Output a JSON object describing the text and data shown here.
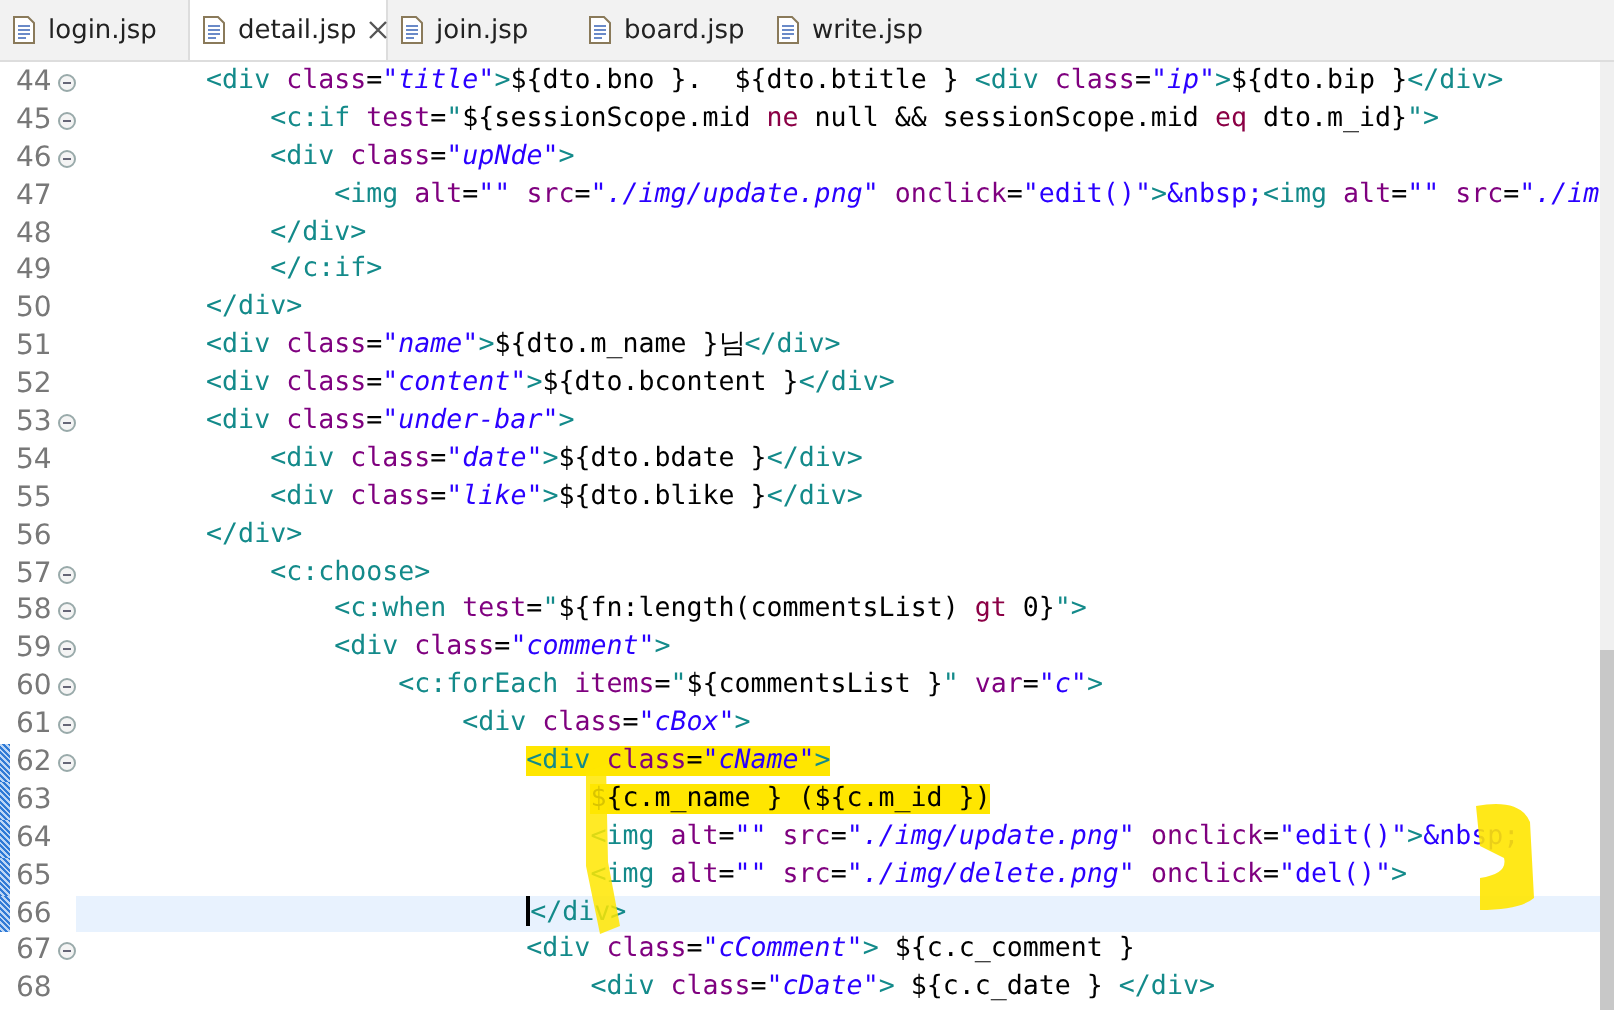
{
  "tabs": [
    {
      "label": "login.jsp",
      "selected": false
    },
    {
      "label": "detail.jsp",
      "selected": true
    },
    {
      "label": "join.jsp",
      "selected": false
    },
    {
      "label": "board.jsp",
      "selected": false
    },
    {
      "label": "write.jsp",
      "selected": false
    }
  ],
  "editor": {
    "lines": [
      {
        "number": "44",
        "fold": true,
        "changed": false,
        "current": false,
        "highlighted": false,
        "tokens": [
          {
            "kind": "tag",
            "text": "        <div"
          },
          {
            "kind": "attr",
            "text": " class"
          },
          {
            "kind": "txt",
            "text": "="
          },
          {
            "kind": "str",
            "text": "\"title\""
          },
          {
            "kind": "tag",
            "text": ">"
          },
          {
            "kind": "el",
            "text": "${dto.bno }.  ${dto.btitle } "
          },
          {
            "kind": "tag",
            "text": "<div"
          },
          {
            "kind": "attr",
            "text": " class"
          },
          {
            "kind": "txt",
            "text": "="
          },
          {
            "kind": "str",
            "text": "\"ip\""
          },
          {
            "kind": "tag",
            "text": ">"
          },
          {
            "kind": "el",
            "text": "${dto.bip }"
          },
          {
            "kind": "tag",
            "text": "</div>"
          }
        ]
      },
      {
        "number": "45",
        "fold": true,
        "changed": false,
        "current": false,
        "highlighted": false,
        "tokens": [
          {
            "kind": "tag",
            "text": "            <c:if"
          },
          {
            "kind": "attr",
            "text": " test"
          },
          {
            "kind": "txt",
            "text": "="
          },
          {
            "kind": "q",
            "text": "\""
          },
          {
            "kind": "el",
            "text": "${sessionScope.mid "
          },
          {
            "kind": "op",
            "text": "ne"
          },
          {
            "kind": "el",
            "text": " null && sessionScope.mid "
          },
          {
            "kind": "op",
            "text": "eq"
          },
          {
            "kind": "el",
            "text": " dto.m_id}"
          },
          {
            "kind": "q",
            "text": "\""
          },
          {
            "kind": "tag",
            "text": ">"
          }
        ]
      },
      {
        "number": "46",
        "fold": true,
        "changed": false,
        "current": false,
        "highlighted": false,
        "tokens": [
          {
            "kind": "tag",
            "text": "            <div"
          },
          {
            "kind": "attr",
            "text": " class"
          },
          {
            "kind": "txt",
            "text": "="
          },
          {
            "kind": "str",
            "text": "\"upNde\""
          },
          {
            "kind": "tag",
            "text": ">"
          }
        ]
      },
      {
        "number": "47",
        "fold": false,
        "changed": false,
        "current": false,
        "highlighted": false,
        "tokens": [
          {
            "kind": "tag",
            "text": "                <img"
          },
          {
            "kind": "attr",
            "text": " alt"
          },
          {
            "kind": "txt",
            "text": "="
          },
          {
            "kind": "str",
            "text": "\"\""
          },
          {
            "kind": "attr",
            "text": " src"
          },
          {
            "kind": "txt",
            "text": "="
          },
          {
            "kind": "str",
            "text": "\"./img/update.png\""
          },
          {
            "kind": "attr",
            "text": " onclick"
          },
          {
            "kind": "txt",
            "text": "="
          },
          {
            "kind": "val",
            "text": "\"edit()\""
          },
          {
            "kind": "tag",
            "text": ">"
          },
          {
            "kind": "ent",
            "text": "&nbsp;"
          },
          {
            "kind": "tag",
            "text": "<img"
          },
          {
            "kind": "attr",
            "text": " alt"
          },
          {
            "kind": "txt",
            "text": "="
          },
          {
            "kind": "str",
            "text": "\"\""
          },
          {
            "kind": "attr",
            "text": " src"
          },
          {
            "kind": "txt",
            "text": "="
          },
          {
            "kind": "str",
            "text": "\"./im"
          }
        ]
      },
      {
        "number": "48",
        "fold": false,
        "changed": false,
        "current": false,
        "highlighted": false,
        "tokens": [
          {
            "kind": "tag",
            "text": "            </div>"
          }
        ]
      },
      {
        "number": "49",
        "fold": false,
        "changed": false,
        "current": false,
        "highlighted": false,
        "tokens": [
          {
            "kind": "tag",
            "text": "            </c:if>"
          }
        ]
      },
      {
        "number": "50",
        "fold": false,
        "changed": false,
        "current": false,
        "highlighted": false,
        "tokens": [
          {
            "kind": "tag",
            "text": "        </div>"
          }
        ]
      },
      {
        "number": "51",
        "fold": false,
        "changed": false,
        "current": false,
        "highlighted": false,
        "tokens": [
          {
            "kind": "tag",
            "text": "        <div"
          },
          {
            "kind": "attr",
            "text": " class"
          },
          {
            "kind": "txt",
            "text": "="
          },
          {
            "kind": "str",
            "text": "\"name\""
          },
          {
            "kind": "tag",
            "text": ">"
          },
          {
            "kind": "el",
            "text": "${dto.m_name }님"
          },
          {
            "kind": "tag",
            "text": "</div>"
          }
        ]
      },
      {
        "number": "52",
        "fold": false,
        "changed": false,
        "current": false,
        "highlighted": false,
        "tokens": [
          {
            "kind": "tag",
            "text": "        <div"
          },
          {
            "kind": "attr",
            "text": " class"
          },
          {
            "kind": "txt",
            "text": "="
          },
          {
            "kind": "str",
            "text": "\"content\""
          },
          {
            "kind": "tag",
            "text": ">"
          },
          {
            "kind": "el",
            "text": "${dto.bcontent }"
          },
          {
            "kind": "tag",
            "text": "</div>"
          }
        ]
      },
      {
        "number": "53",
        "fold": true,
        "changed": false,
        "current": false,
        "highlighted": false,
        "tokens": [
          {
            "kind": "tag",
            "text": "        <div"
          },
          {
            "kind": "attr",
            "text": " class"
          },
          {
            "kind": "txt",
            "text": "="
          },
          {
            "kind": "str",
            "text": "\"under-bar\""
          },
          {
            "kind": "tag",
            "text": ">"
          }
        ]
      },
      {
        "number": "54",
        "fold": false,
        "changed": false,
        "current": false,
        "highlighted": false,
        "tokens": [
          {
            "kind": "tag",
            "text": "            <div"
          },
          {
            "kind": "attr",
            "text": " class"
          },
          {
            "kind": "txt",
            "text": "="
          },
          {
            "kind": "str",
            "text": "\"date\""
          },
          {
            "kind": "tag",
            "text": ">"
          },
          {
            "kind": "el",
            "text": "${dto.bdate }"
          },
          {
            "kind": "tag",
            "text": "</div>"
          }
        ]
      },
      {
        "number": "55",
        "fold": false,
        "changed": false,
        "current": false,
        "highlighted": false,
        "tokens": [
          {
            "kind": "tag",
            "text": "            <div"
          },
          {
            "kind": "attr",
            "text": " class"
          },
          {
            "kind": "txt",
            "text": "="
          },
          {
            "kind": "str",
            "text": "\"like\""
          },
          {
            "kind": "tag",
            "text": ">"
          },
          {
            "kind": "el",
            "text": "${dto.blike }"
          },
          {
            "kind": "tag",
            "text": "</div>"
          }
        ]
      },
      {
        "number": "56",
        "fold": false,
        "changed": false,
        "current": false,
        "highlighted": false,
        "tokens": [
          {
            "kind": "tag",
            "text": "        </div>"
          }
        ]
      },
      {
        "number": "57",
        "fold": true,
        "changed": false,
        "current": false,
        "highlighted": false,
        "tokens": [
          {
            "kind": "tag",
            "text": "            <c:choose>"
          }
        ]
      },
      {
        "number": "58",
        "fold": true,
        "changed": false,
        "current": false,
        "highlighted": false,
        "tokens": [
          {
            "kind": "tag",
            "text": "                <c:when"
          },
          {
            "kind": "attr",
            "text": " test"
          },
          {
            "kind": "txt",
            "text": "="
          },
          {
            "kind": "q",
            "text": "\""
          },
          {
            "kind": "el",
            "text": "${fn:length(commentsList) "
          },
          {
            "kind": "op",
            "text": "gt"
          },
          {
            "kind": "el",
            "text": " 0}"
          },
          {
            "kind": "q",
            "text": "\""
          },
          {
            "kind": "tag",
            "text": ">"
          }
        ]
      },
      {
        "number": "59",
        "fold": true,
        "changed": false,
        "current": false,
        "highlighted": false,
        "tokens": [
          {
            "kind": "tag",
            "text": "                <div"
          },
          {
            "kind": "attr",
            "text": " class"
          },
          {
            "kind": "txt",
            "text": "="
          },
          {
            "kind": "str",
            "text": "\"comment\""
          },
          {
            "kind": "tag",
            "text": ">"
          }
        ]
      },
      {
        "number": "60",
        "fold": true,
        "changed": false,
        "current": false,
        "highlighted": false,
        "tokens": [
          {
            "kind": "tag",
            "text": "                    <c:forEach"
          },
          {
            "kind": "attr",
            "text": " items"
          },
          {
            "kind": "txt",
            "text": "="
          },
          {
            "kind": "q",
            "text": "\""
          },
          {
            "kind": "el",
            "text": "${commentsList }"
          },
          {
            "kind": "q",
            "text": "\""
          },
          {
            "kind": "attr",
            "text": " var"
          },
          {
            "kind": "txt",
            "text": "="
          },
          {
            "kind": "str",
            "text": "\"c\""
          },
          {
            "kind": "tag",
            "text": ">"
          }
        ]
      },
      {
        "number": "61",
        "fold": true,
        "changed": false,
        "current": false,
        "highlighted": false,
        "tokens": [
          {
            "kind": "tag",
            "text": "                        <div"
          },
          {
            "kind": "attr",
            "text": " class"
          },
          {
            "kind": "txt",
            "text": "="
          },
          {
            "kind": "str",
            "text": "\"cBox\""
          },
          {
            "kind": "tag",
            "text": ">"
          }
        ]
      },
      {
        "number": "62",
        "fold": true,
        "changed": true,
        "current": false,
        "highlighted": true,
        "tokens": [
          {
            "kind": "tag",
            "text": "                            <div"
          },
          {
            "kind": "attr",
            "text": " class"
          },
          {
            "kind": "txt",
            "text": "="
          },
          {
            "kind": "str",
            "text": "\"cName\""
          },
          {
            "kind": "tag",
            "text": ">"
          }
        ]
      },
      {
        "number": "63",
        "fold": false,
        "changed": true,
        "current": false,
        "highlighted": true,
        "tokens": [
          {
            "kind": "el",
            "text": "                                ${c.m_name } (${c.m_id })"
          }
        ]
      },
      {
        "number": "64",
        "fold": false,
        "changed": true,
        "current": false,
        "highlighted": false,
        "tokens": [
          {
            "kind": "tag",
            "text": "                                <img"
          },
          {
            "kind": "attr",
            "text": " alt"
          },
          {
            "kind": "txt",
            "text": "="
          },
          {
            "kind": "str",
            "text": "\"\""
          },
          {
            "kind": "attr",
            "text": " src"
          },
          {
            "kind": "txt",
            "text": "="
          },
          {
            "kind": "str",
            "text": "\"./img/update.png\""
          },
          {
            "kind": "attr",
            "text": " onclick"
          },
          {
            "kind": "txt",
            "text": "="
          },
          {
            "kind": "val",
            "text": "\"edit()\""
          },
          {
            "kind": "tag",
            "text": ">"
          },
          {
            "kind": "ent",
            "text": "&nbsp;"
          }
        ]
      },
      {
        "number": "65",
        "fold": false,
        "changed": true,
        "current": false,
        "highlighted": false,
        "tokens": [
          {
            "kind": "tag",
            "text": "                                <img"
          },
          {
            "kind": "attr",
            "text": " alt"
          },
          {
            "kind": "txt",
            "text": "="
          },
          {
            "kind": "str",
            "text": "\"\""
          },
          {
            "kind": "attr",
            "text": " src"
          },
          {
            "kind": "txt",
            "text": "="
          },
          {
            "kind": "str",
            "text": "\"./img/delete.png\""
          },
          {
            "kind": "attr",
            "text": " onclick"
          },
          {
            "kind": "txt",
            "text": "="
          },
          {
            "kind": "val",
            "text": "\"del()\""
          },
          {
            "kind": "tag",
            "text": ">"
          }
        ]
      },
      {
        "number": "66",
        "fold": false,
        "changed": true,
        "current": true,
        "highlighted": false,
        "tokens": [
          {
            "kind": "tag",
            "text": "                            </div>"
          }
        ]
      },
      {
        "number": "67",
        "fold": true,
        "changed": false,
        "current": false,
        "highlighted": false,
        "tokens": [
          {
            "kind": "tag",
            "text": "                            <div"
          },
          {
            "kind": "attr",
            "text": " class"
          },
          {
            "kind": "txt",
            "text": "="
          },
          {
            "kind": "str",
            "text": "\"cComment\""
          },
          {
            "kind": "tag",
            "text": ">"
          },
          {
            "kind": "el",
            "text": " ${c.c_comment }"
          }
        ]
      },
      {
        "number": "68",
        "fold": false,
        "changed": false,
        "current": false,
        "highlighted": false,
        "tokens": [
          {
            "kind": "tag",
            "text": "                                <div"
          },
          {
            "kind": "attr",
            "text": " class"
          },
          {
            "kind": "txt",
            "text": "="
          },
          {
            "kind": "str",
            "text": "\"cDate\""
          },
          {
            "kind": "tag",
            "text": ">"
          },
          {
            "kind": "el",
            "text": " ${c.c_date } "
          },
          {
            "kind": "tag",
            "text": "</div>"
          }
        ]
      }
    ]
  }
}
